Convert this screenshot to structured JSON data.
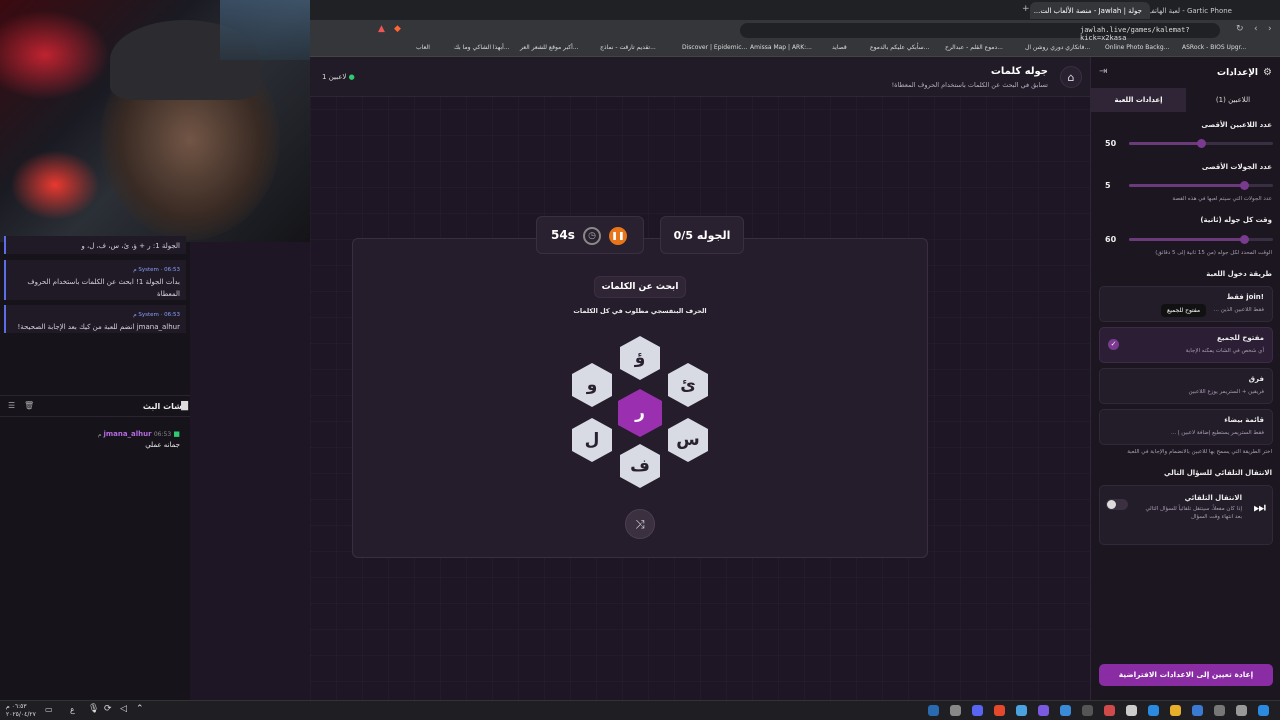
{
  "browser": {
    "tabs": [
      {
        "label": "Gartic Phone - لعبة الهاتف المكسور"
      },
      {
        "label": "جولة | Jawlah - منصة الألعاب الت..."
      }
    ],
    "url": "jawlah.live/games/kalemat?kick=x2kasa",
    "bookmarks": [
      "ASRock - BIOS Upgr...",
      "Online Photo Backg...",
      "فاتكاري دوري روشن ال...",
      "دموع القلم - عبدالرح...",
      "سأبكي عليكم بالدموع...",
      "قصايد",
      "Amissa Map | ARK:...",
      "Discover | Epidemic...",
      "تقديم تارقت - نماذج...",
      "أكبر موقع للشعر العر...",
      "أبهذا الشاكي وما بك...",
      "العاب"
    ]
  },
  "stream_chat": {
    "messages": [
      {
        "text": "الجولة 1: ر + ؤ، ئ، س، ف، ل، و"
      },
      {
        "user": "System",
        "time": "06:53 م",
        "text": "بدأت الجولة 1! ابحث عن الكلمات باستخدام الحروف المعطاة"
      },
      {
        "user": "System",
        "time": "06:53 م",
        "text": "jmana_alhur انضم للعبة من كيك بعد الإجابة الصحيحة!"
      }
    ],
    "title": "شات البث",
    "chat_message": {
      "user": "jmana_alhur",
      "time": "06:53 م",
      "text": "جمانه عملي"
    }
  },
  "header": {
    "title": "جوله كلمات",
    "subtitle": "تسابق في البحث عن الكلمات باستخدام الحروف المعطاة!",
    "players_online": "1 لاعبين"
  },
  "game": {
    "round_label": "الجوله 0/5",
    "timer": "54s",
    "prompt_title": "ابحث عن الكلمات",
    "instruction": "الحرف البنفسجي مطلوب في كل الكلمات",
    "letters": {
      "center": "ر",
      "top": "ؤ",
      "top_right": "ئ",
      "bottom_right": "س",
      "bottom": "ف",
      "bottom_left": "ل",
      "top_left": "و"
    }
  },
  "settings": {
    "title": "الإعدادات",
    "tabs": [
      "اللاعبين (1)",
      "إعدادات اللعبة"
    ],
    "max_players_label": "عدد اللاعبين الأقصى",
    "max_players": "50",
    "max_players_frac": 0.5,
    "max_rounds_label": "عدد الجولات الأقصى",
    "max_rounds": "5",
    "max_rounds_frac": 0.8,
    "rounds_desc": "عدد الجولات التي سيتم لعبها في هذه القصة",
    "round_time_label": "وقت كل جوله (ثانية)",
    "round_time": "60",
    "round_time_frac": 0.8,
    "round_time_desc": "الوقت المحدد لكل جوله (من 15 ثانية إلى 5 دقائق)",
    "entry_label": "طريقة دخول اللعبة",
    "options": [
      {
        "title": "!join فقط",
        "desc": "فقط اللاعبين الذين ..."
      },
      {
        "title": "مفتوح للجميع",
        "desc": "أي شخص في الشات يمكنه الإجابة"
      },
      {
        "title": "فرق",
        "desc": "فريقين + الستريمر يوزع اللاعبين"
      },
      {
        "title": "قائمة بيضاء",
        "desc": "فقط الستريمر يستطيع إضافة لاعبين إ ..."
      }
    ],
    "tooltip": "مفتوح للجميع",
    "entry_desc": "اختر الطريقة التي يسمح بها للاعبين بالانضمام والإجابة في اللعبة",
    "auto_label": "الانتقال التلقائي للسؤال التالي",
    "auto_title": "الانتقال التلقائي",
    "auto_desc": "إذا كان مفعلاً، سينتقل تلقائياً للسؤال التالي بعد انتهاء وقت السؤال",
    "reset_button": "إعادة تعيين إلى الاعدادات الافتراضية"
  },
  "taskbar": {
    "clock": "٠٦:٥٣ م",
    "date": "٢٠٢٥/٠٤/٢٧",
    "lang": "ع"
  }
}
